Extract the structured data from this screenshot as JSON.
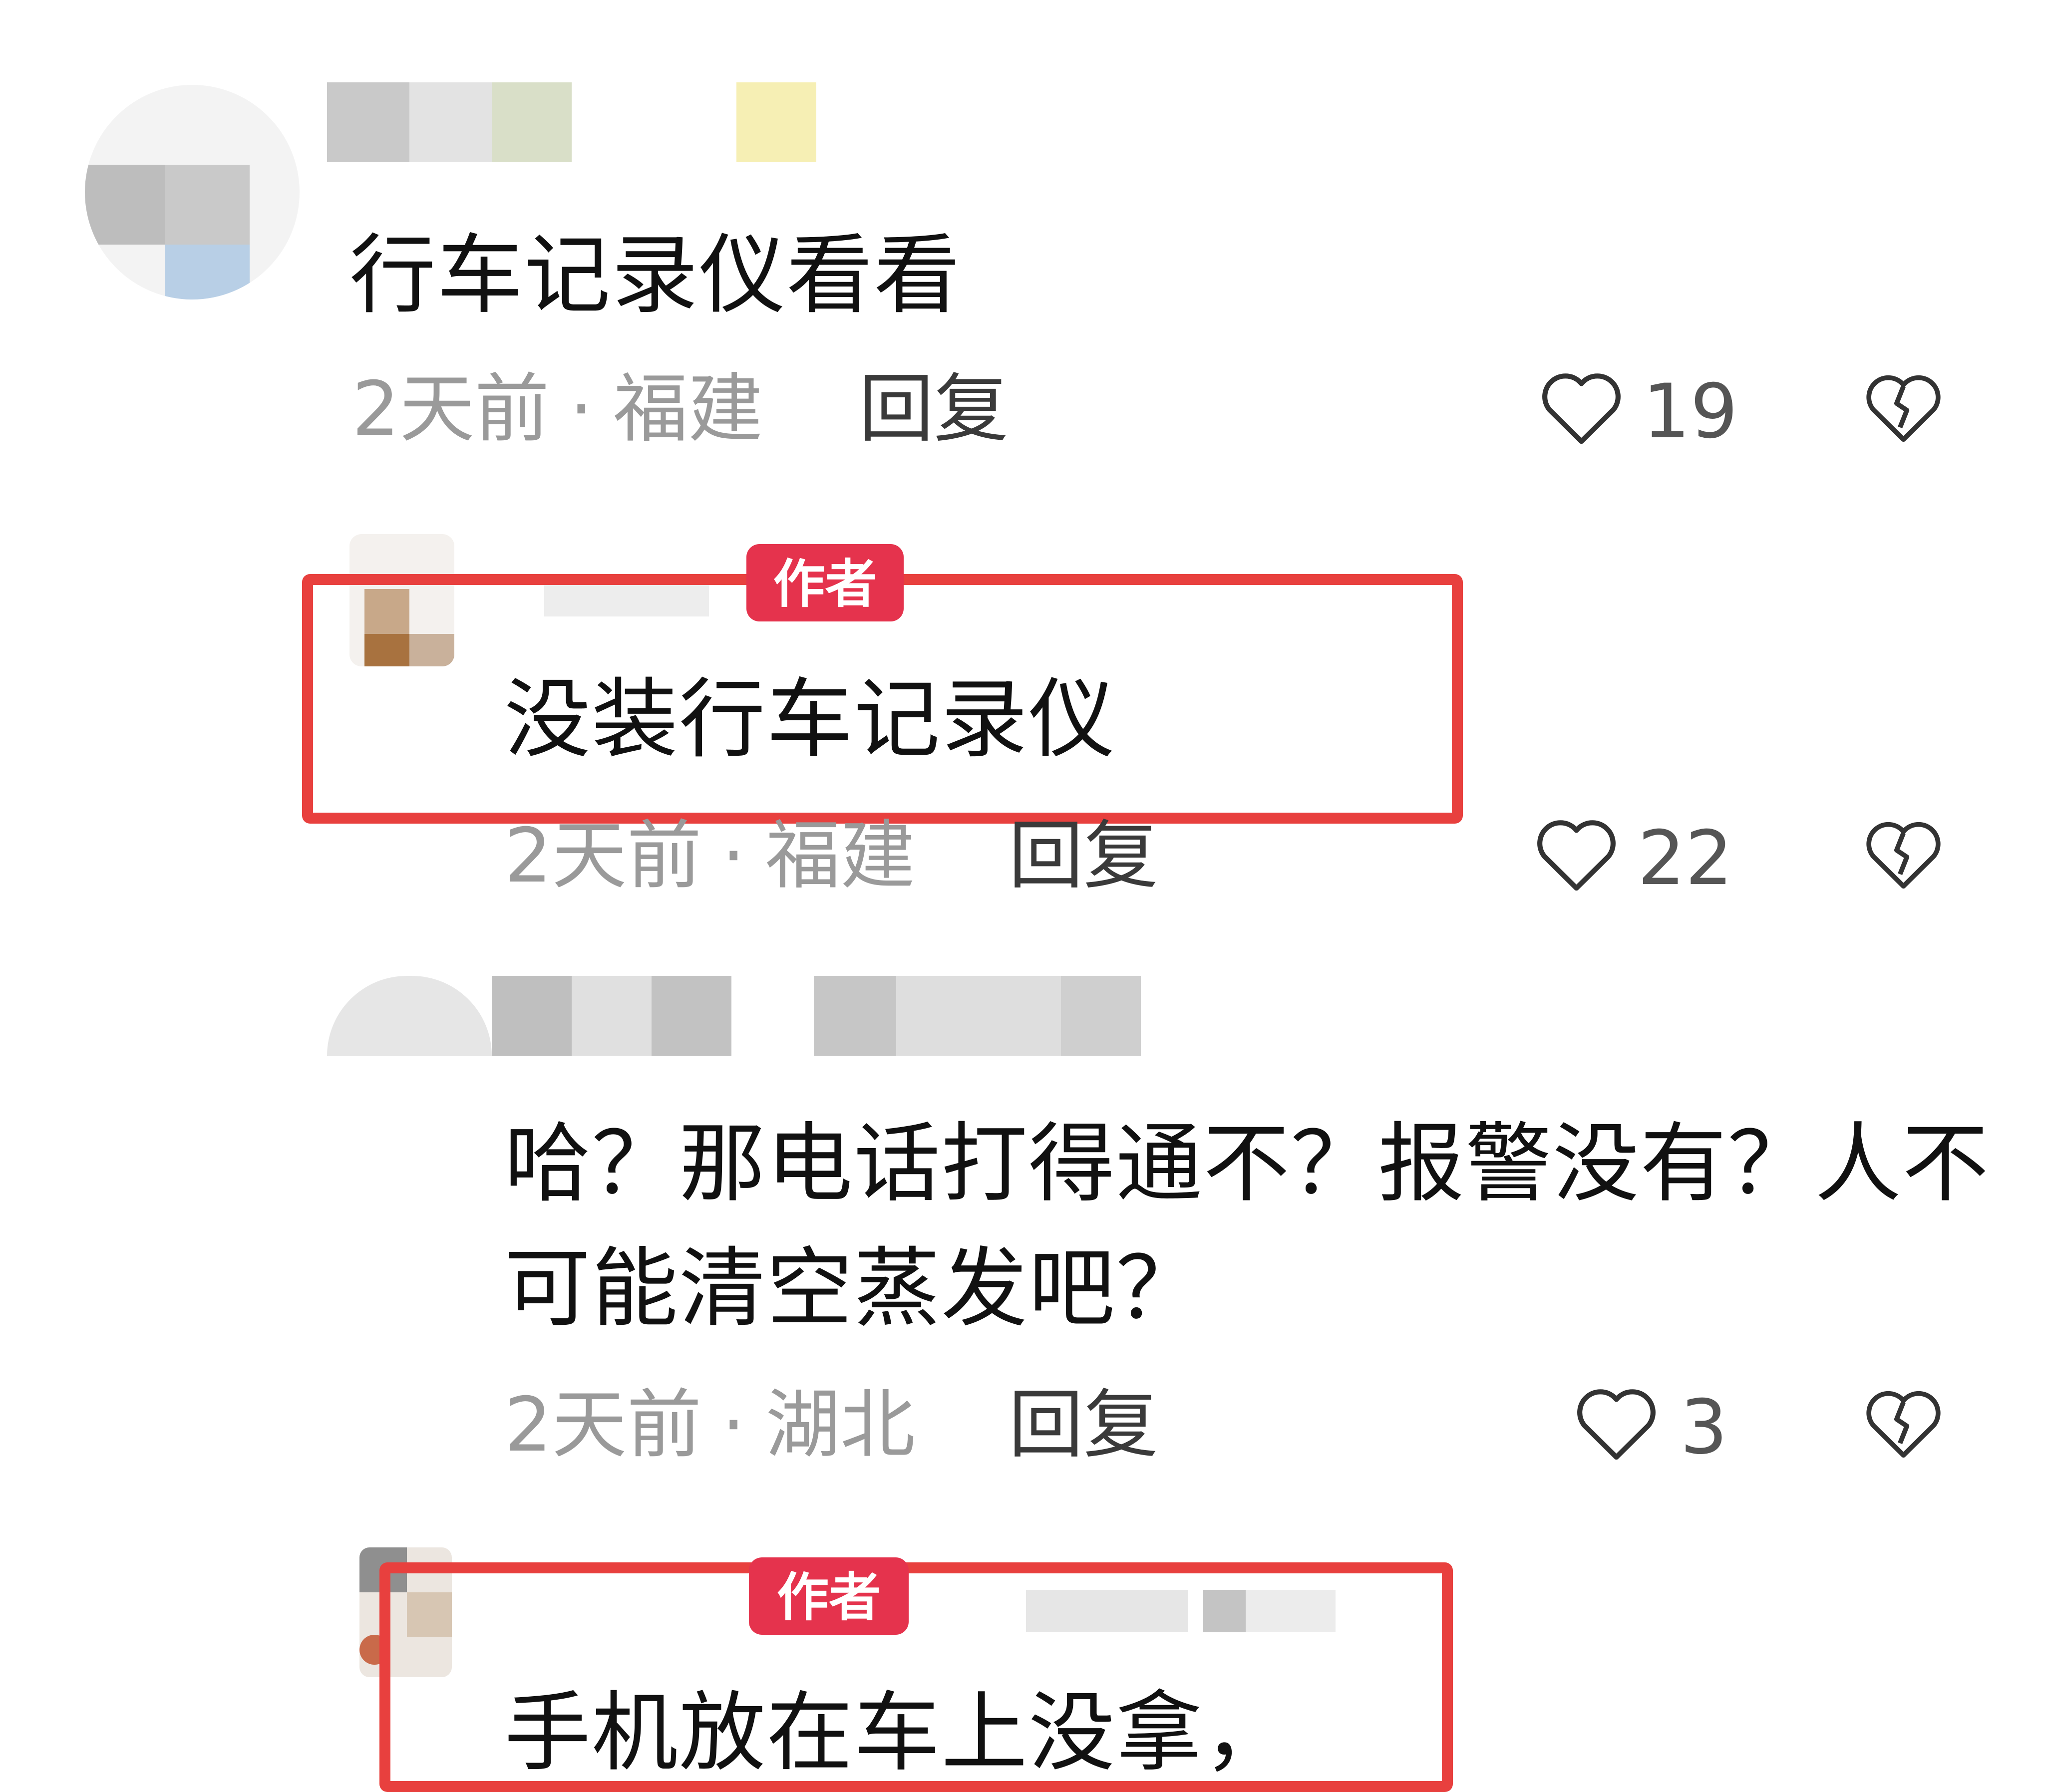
{
  "comments": [
    {
      "text": "行车记录仪看看",
      "time": "2天前",
      "separator": "·",
      "location": "福建",
      "reply_label": "回复",
      "likes": "19"
    },
    {
      "badge": "作者",
      "text": "没装行车记录仪",
      "time": "2天前",
      "separator": "·",
      "location": "福建",
      "reply_label": "回复",
      "likes": "22"
    },
    {
      "text_line1": "哈？那电话打得通不？报警没有？人不",
      "text_line2": "可能清空蒸发吧？",
      "time": "2天前",
      "separator": "·",
      "location": "湖北",
      "reply_label": "回复",
      "likes": "3"
    },
    {
      "badge": "作者",
      "text": "手机放在车上没拿，"
    }
  ],
  "colors": {
    "highlight": "#e8403e",
    "badge": "#e5334d"
  },
  "icons": {
    "like": "heart-outline-icon",
    "dislike": "broken-heart-icon"
  }
}
